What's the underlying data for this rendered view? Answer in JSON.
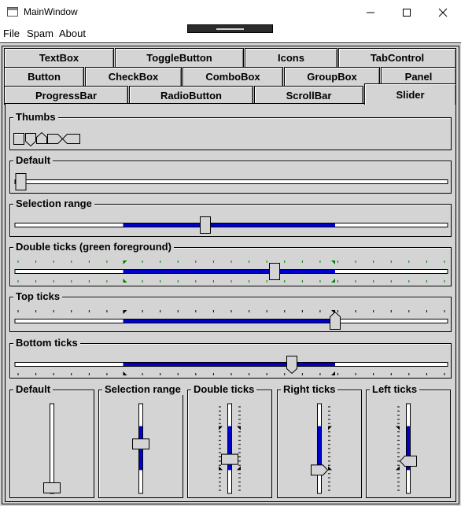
{
  "window": {
    "title": "MainWindow",
    "minimize_glyph": "minimize-icon",
    "maximize_glyph": "maximize-icon",
    "close_glyph": "close-icon"
  },
  "menu": {
    "items": [
      "File",
      "Spam",
      "About"
    ]
  },
  "tabs": {
    "row1": [
      "TextBox",
      "ToggleButton",
      "Icons",
      "TabControl"
    ],
    "row2": [
      "Button",
      "CheckBox",
      "ComboBox",
      "GroupBox",
      "Panel"
    ],
    "row3": [
      "ProgressBar",
      "RadioButton",
      "ScrollBar",
      "Slider"
    ],
    "active": "Slider"
  },
  "groups": {
    "thumbs": "Thumbs",
    "default": "Default",
    "selection_range": "Selection range",
    "double_ticks": "Double ticks (green foreground)",
    "top_ticks": "Top ticks",
    "bottom_ticks": "Bottom ticks",
    "v_default": "Default",
    "v_selection_range": "Selection range",
    "v_double_ticks": "Double ticks",
    "v_right_ticks": "Right ticks",
    "v_left_ticks": "Left ticks"
  },
  "sliders": {
    "default": {
      "value": 0.0
    },
    "selection_range": {
      "value": 0.44,
      "sel_start": 0.25,
      "sel_end": 0.74
    },
    "double_ticks": {
      "value": 0.6,
      "sel_start": 0.25,
      "sel_end": 0.74
    },
    "top_ticks": {
      "value": 0.74,
      "sel_start": 0.25,
      "sel_end": 0.74
    },
    "bottom_ticks": {
      "value": 0.64,
      "sel_start": 0.25,
      "sel_end": 0.74
    },
    "v_default": {
      "value": 0.0
    },
    "v_selection_range": {
      "value": 0.45,
      "sel_start": 0.25,
      "sel_end": 0.74
    },
    "v_double_ticks": {
      "value": 0.62,
      "sel_start": 0.25,
      "sel_end": 0.74
    },
    "v_right_ticks": {
      "value": 0.74,
      "sel_start": 0.25,
      "sel_end": 0.74
    },
    "v_left_ticks": {
      "value": 0.64,
      "sel_start": 0.25,
      "sel_end": 0.74
    }
  },
  "colors": {
    "selection": "#0000cc",
    "tick": "#000000",
    "tick_green": "#008000",
    "face": "#d4d4d4",
    "track": "#ffffff"
  }
}
